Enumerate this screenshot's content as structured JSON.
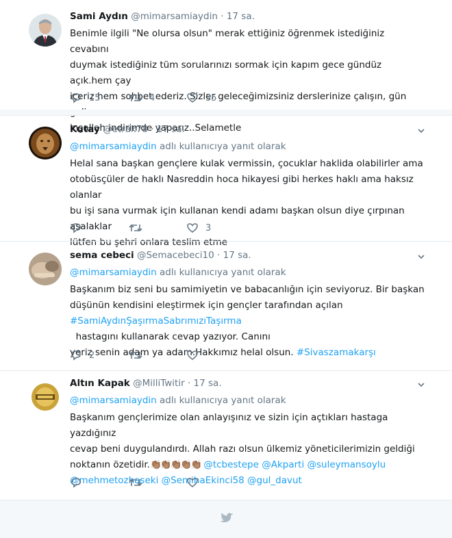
{
  "tweets": [
    {
      "name": "Sami Aydın",
      "handle": "@mimarsamiaydin",
      "time": "17 sa.",
      "reply_prefix": "",
      "reply_mention": "",
      "reply_suffix": "",
      "lines": [
        "Benimle ilgili \"Ne olursa olsun\" merak ettiğiniz öğrenmek istediğiniz cevabını",
        "duymak istediğiniz tüm sorularınızı sormak için kapım gece gündüz açık.hem çay",
        "içeriz hem sohbet ederiz. Sizler geleceğimizsiniz derslerinize çalışın, gün gelir",
        "inşallah indirimde yaparız..Selametle"
      ],
      "counts": {
        "reply": "15",
        "retweet": "4",
        "like": "35"
      }
    },
    {
      "name": "Kutay",
      "handle": "@etrak78",
      "time": "17 sa.",
      "reply_mention": "@mimarsamiaydin",
      "reply_suffix": "adlı kullanıcıya yanıt olarak",
      "lines": [
        "Helal sana başkan gençlere kulak vermissin, çocuklar haklida olabilirler ama",
        "otobüsçüler de haklı Nasreddin hoca hikayesi gibi herkes haklı ama haksız olanlar",
        "bu işi sana vurmak için kullanan kendi adamı başkan olsun diye çırpınan asalaklar",
        "lütfen bu şehri onlara teslim etme"
      ],
      "counts": {
        "reply": "",
        "retweet": "",
        "like": "3"
      }
    },
    {
      "name": "sema cebeci",
      "handle": "@Semacebeci10",
      "time": "17 sa.",
      "reply_mention": "@mimarsamiaydin",
      "reply_suffix": "adlı kullanıcıya yanıt olarak",
      "line1": "Başkanım biz seni bu samimiyetin ve babacanlığın için seviyoruz. Bir başkan",
      "line2": "düşünün kendisini eleştirmek için gençler tarafından açılan",
      "hashtag1": "#SamiAydınŞaşırmaSabrımızıTaşırma",
      "line3_after": "  hastagını kullanarak cevap yazıyor. Canını",
      "line4_before": "yeriz senin adam ya adam.Hakkımız helal olsun.",
      "hashtag2": "#Sivaszamakarşı",
      "counts": {
        "reply": "2",
        "retweet": "",
        "like": ""
      }
    },
    {
      "name": "Altın Kapak",
      "handle": "@MilliTwitir",
      "time": "17 sa.",
      "reply_mention": "@mimarsamiaydin",
      "reply_suffix": "adlı kullanıcıya yanıt olarak",
      "line1": "Başkanım gençlerimize olan anlayışınız ve sizin için açtıkları hastaga yazdığınız",
      "line2": "cevap beni duygulandırdı. Allah razı olsun ülkemiz  yöneticilerimizin geldiği",
      "line3_before": "noktanın özetidir.",
      "emoji": "👏🏽👏🏽👏🏽👏🏽👏🏽",
      "mentions_line3": "@tcbestepe @Akparti @suleymansoylu",
      "mentions_line4": "@mehmetozhaseki @SemihaEkinci58 @gul_davut",
      "counts": {
        "reply": "",
        "retweet": "",
        "like": ""
      }
    }
  ],
  "colors": {
    "link": "#1da1f2",
    "muted": "#657786",
    "divider": "#e6ecf0"
  },
  "icons": [
    "reply-icon",
    "retweet-icon",
    "like-icon",
    "caret-down-icon",
    "twitter-bird-icon"
  ]
}
